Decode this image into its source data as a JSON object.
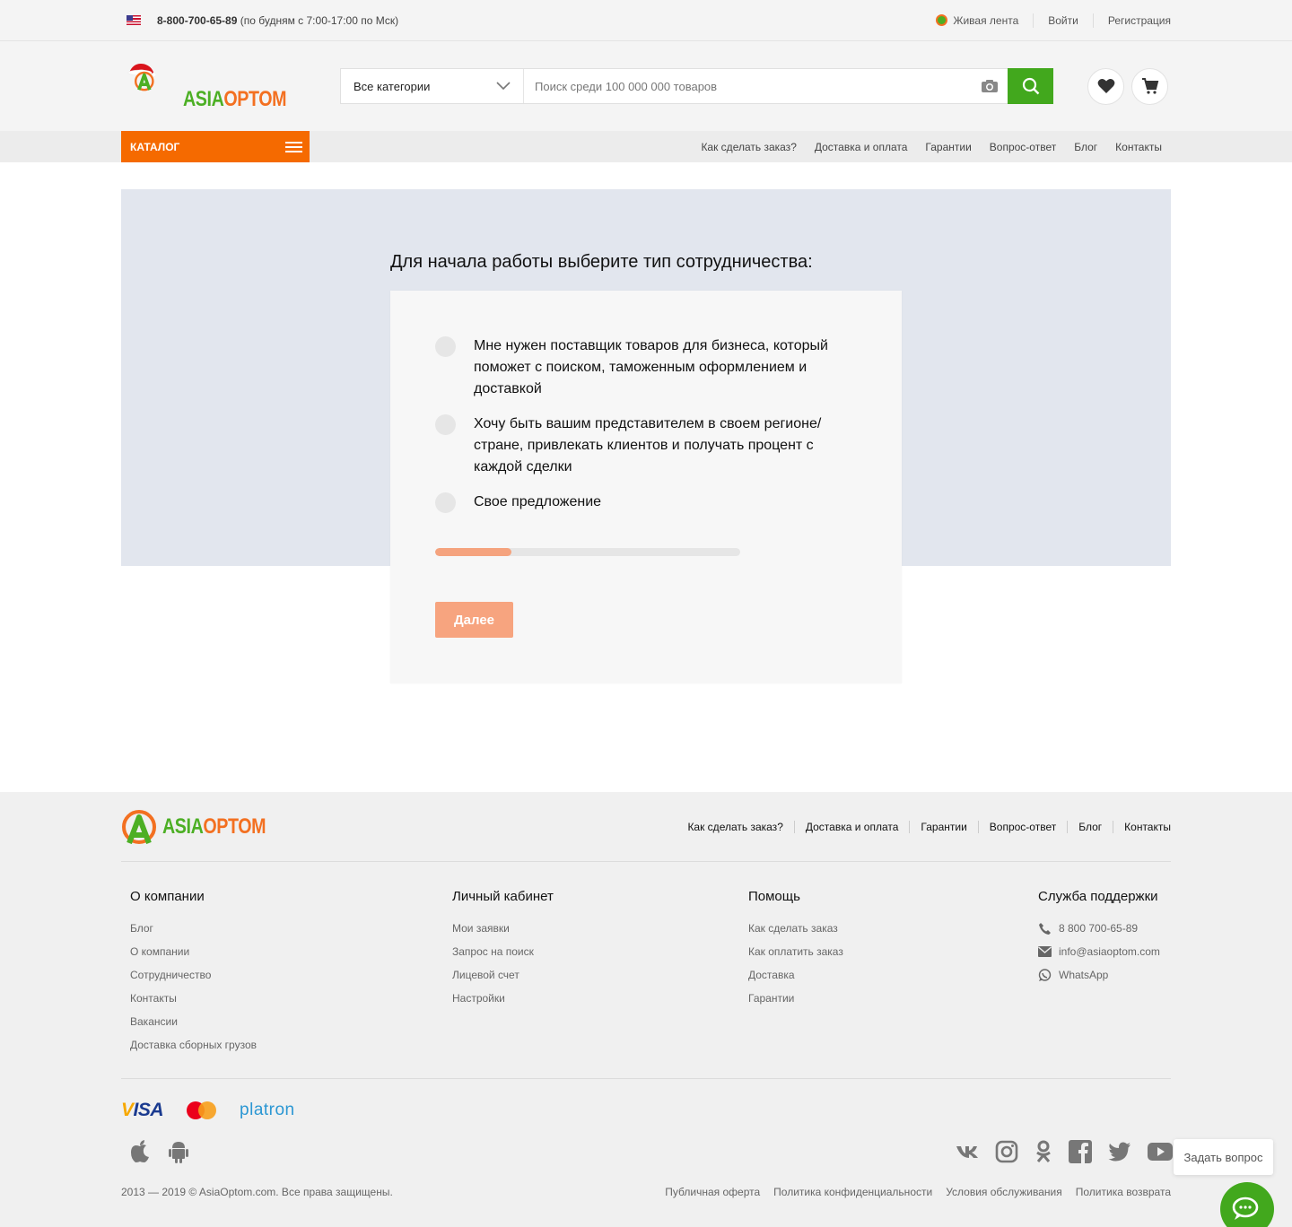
{
  "topbar": {
    "phone": "8-800-700-65-89",
    "hours": "(по будням с 7:00-17:00 по Мск)",
    "live_feed": "Живая лента",
    "login": "Войти",
    "register": "Регистрация"
  },
  "logo": {
    "part1": "ASIA",
    "part2": "OPTOM"
  },
  "search": {
    "category": "Все категории",
    "placeholder": "Поиск среди 100 000 000 товаров"
  },
  "nav": {
    "catalog": "КАТАЛОГ",
    "links": [
      "Как сделать заказ?",
      "Доставка и оплата",
      "Гарантии",
      "Вопрос-ответ",
      "Блог",
      "Контакты"
    ]
  },
  "form": {
    "title": "Для начала работы выберите тип сотрудничества:",
    "options": [
      "Мне нужен поставщик товаров для бизнеса, который поможет с поиском, таможенным оформлением и доставкой",
      "Хочу быть вашим представителем в своем регионе/ стране, привлекать клиентов и получать процент с каждой сделки",
      "Свое предложение"
    ],
    "progress_percent": 25,
    "next_label": "Далее"
  },
  "footer": {
    "links": [
      "Как сделать заказ?",
      "Доставка и оплата",
      "Гарантии",
      "Вопрос-ответ",
      "Блог",
      "Контакты"
    ],
    "columns": [
      {
        "title": "О компании",
        "items": [
          "Блог",
          "О компании",
          "Сотрудничество",
          "Контакты",
          "Вакансии",
          "Доставка сборных грузов"
        ]
      },
      {
        "title": "Личный кабинет",
        "items": [
          "Мои заявки",
          "Запрос на поиск",
          "Лицевой счет",
          "Настройки"
        ]
      },
      {
        "title": "Помощь",
        "items": [
          "Как сделать заказ",
          "Как оплатить заказ",
          "Доставка",
          "Гарантии"
        ]
      }
    ],
    "support": {
      "title": "Служба поддержки",
      "phone": "8 800 700-65-89",
      "email": "info@asiaoptom.com",
      "whatsapp": "WhatsApp"
    },
    "payments": {
      "visa": "VISA",
      "platron": "platron"
    },
    "copyright": "2013 — 2019 © AsiaOptom.com. Все права защищены.",
    "legal": [
      "Публичная оферта",
      "Политика конфиденциальности",
      "Условия обслуживания",
      "Политика возврата"
    ]
  },
  "ask_question": "Задать вопрос",
  "colors": {
    "orange": "#f56a00",
    "green": "#42a81d",
    "hero_bg": "#e2e6ee"
  },
  "icons": [
    "flag-us-icon",
    "camera-icon",
    "search-icon",
    "heart-icon",
    "cart-icon",
    "burger-icon",
    "phone-icon",
    "mail-icon",
    "whatsapp-icon",
    "apple-icon",
    "android-icon",
    "vk-icon",
    "instagram-icon",
    "odnoklassniki-icon",
    "facebook-icon",
    "twitter-icon",
    "youtube-icon",
    "chat-icon"
  ]
}
